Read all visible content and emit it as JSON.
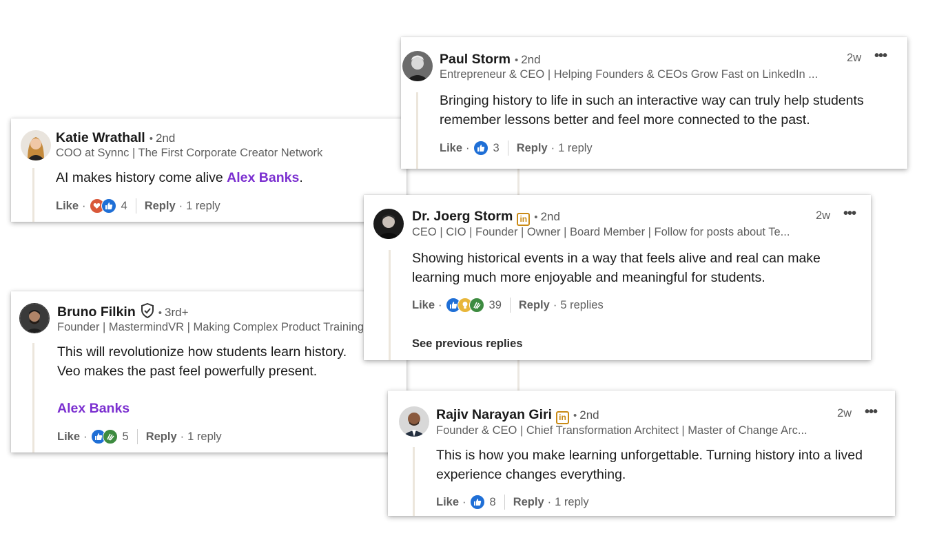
{
  "comments": [
    {
      "name": "Katie Wrathall",
      "degree": "2nd",
      "headline": "COO at Synnc | The First Corporate Creator Network",
      "body_prefix": "AI makes history come alive ",
      "mention": "Alex Banks",
      "body_suffix": ".",
      "like": "Like",
      "reaction_count": "4",
      "reply": "Reply",
      "replies": "1 reply",
      "reactions": [
        "heart-icon",
        "thumbs-up-icon"
      ]
    },
    {
      "name": "Paul Storm",
      "degree": "2nd",
      "time": "2w",
      "headline": "Entrepreneur & CEO | Helping Founders & CEOs Grow Fast on LinkedIn ...",
      "body": "Bringing history to life in such an interactive way can truly help students remember lessons better and feel more connected to the past.",
      "like": "Like",
      "reaction_count": "3",
      "reply": "Reply",
      "replies": "1 reply",
      "reactions": [
        "thumbs-up-icon"
      ]
    },
    {
      "name": "Dr. Joerg Storm",
      "degree": "2nd",
      "time": "2w",
      "headline": "CEO | CIO | Founder | Owner | Board Member | Follow for posts about Te...",
      "body": "Showing historical events in a way that feels alive and real can make learning much more enjoyable and meaningful for students.",
      "like": "Like",
      "reaction_count": "39",
      "reply": "Reply",
      "replies": "5 replies",
      "see_previous": "See previous replies",
      "reactions": [
        "thumbs-up-icon",
        "lightbulb-icon",
        "clap-icon"
      ]
    },
    {
      "name": "Bruno Filkin",
      "degree": "3rd+",
      "headline": "Founder | MastermindVR | Making Complex Product Training",
      "body_line1": "This will revolutionize how students learn history.",
      "body_line2": "Veo makes the past feel powerfully present.",
      "mention": "Alex Banks",
      "like": "Like",
      "reaction_count": "5",
      "reply": "Reply",
      "replies": "1 reply",
      "reactions": [
        "thumbs-up-icon",
        "clap-icon"
      ]
    },
    {
      "name": "Rajiv Narayan Giri",
      "degree": "2nd",
      "time": "2w",
      "headline": "Founder & CEO | Chief Transformation Architect | Master of Change Arc...",
      "body": "This is how you make learning unforgettable. Turning history into a lived experience changes everything.",
      "like": "Like",
      "reaction_count": "8",
      "reply": "Reply",
      "replies": "1 reply",
      "reactions": [
        "thumbs-up-icon"
      ]
    }
  ],
  "colors": {
    "mention": "#7b2fd0",
    "like_blue": "#1f6fd6",
    "love_red": "#d9583a",
    "clap_green": "#3d8b40",
    "idea_yellow": "#e8b63a",
    "badge_gold": "#c98a15"
  },
  "icons": {
    "more": "more-options-icon",
    "verified": "verified-shield-icon",
    "premium": "linkedin-premium-icon"
  }
}
